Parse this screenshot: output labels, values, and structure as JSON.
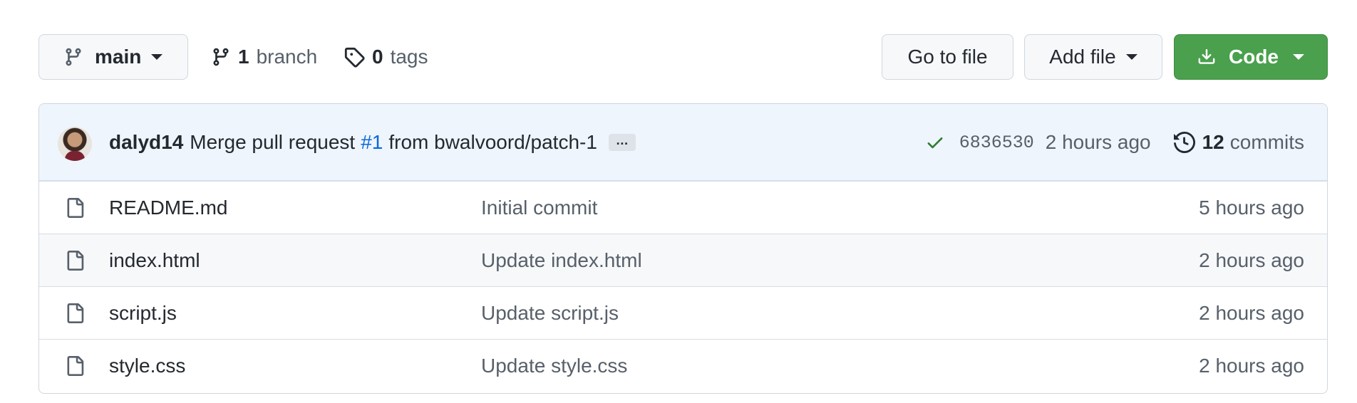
{
  "branch_selector": {
    "label": "main"
  },
  "branches": {
    "count": "1",
    "word": "branch"
  },
  "tags": {
    "count": "0",
    "word": "tags"
  },
  "actions": {
    "go_to_file": "Go to file",
    "add_file": "Add file",
    "code": "Code"
  },
  "colors": {
    "code_button": "#4aa04d",
    "link": "#0969da",
    "check": "#2f7d32",
    "commit_bar": "#eef5fd"
  },
  "latest_commit": {
    "author": "dalyd14",
    "message_prefix": "Merge pull request",
    "pr_link": "#1",
    "message_suffix": "from bwalvoord/patch-1",
    "more": "…",
    "sha": "6836530",
    "age": "2 hours ago",
    "commits_count": "12",
    "commits_word": "commits"
  },
  "files": [
    {
      "name": "README.md",
      "message": "Initial commit",
      "age": "5 hours ago"
    },
    {
      "name": "index.html",
      "message": "Update index.html",
      "age": "2 hours ago"
    },
    {
      "name": "script.js",
      "message": "Update script.js",
      "age": "2 hours ago"
    },
    {
      "name": "style.css",
      "message": "Update style.css",
      "age": "2 hours ago"
    }
  ],
  "icons": [
    "git-branch-icon",
    "tag-icon",
    "download-icon",
    "check-icon",
    "history-icon",
    "file-icon"
  ]
}
